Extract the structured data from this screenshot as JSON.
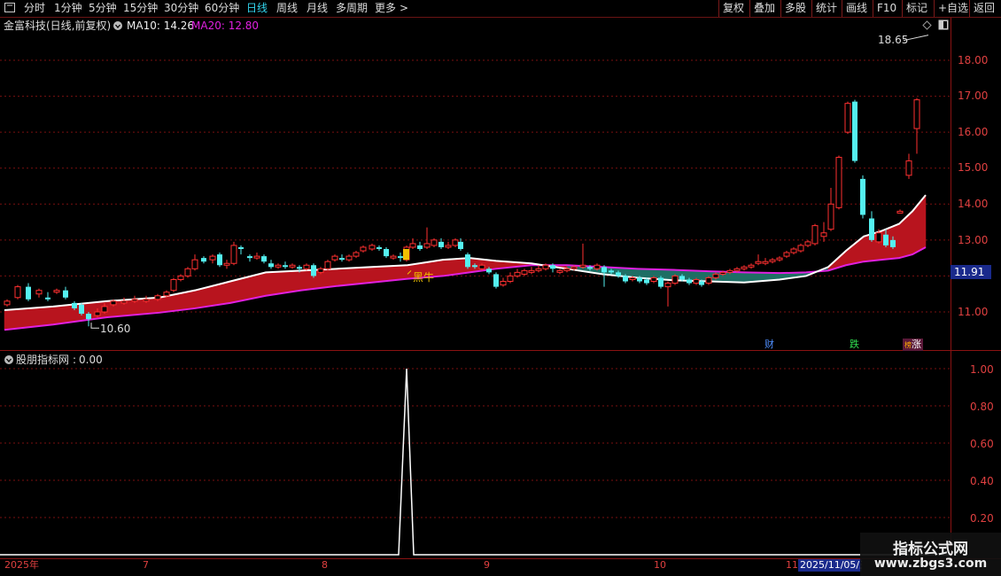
{
  "toolbar": {
    "left_items": [
      "分时",
      "1分钟",
      "5分钟",
      "15分钟",
      "30分钟",
      "60分钟",
      "日线",
      "周线",
      "月线",
      "多周期",
      "更多"
    ],
    "active": "日线",
    "more_arrow": ">",
    "right_items": [
      "复权",
      "叠加",
      "多股",
      "统计",
      "画线",
      "F10",
      "标记",
      "+自选",
      "返回"
    ]
  },
  "main": {
    "title": "金富科技(日线,前复权)",
    "ma10_label": "MA10: 14.26",
    "ma20_label": "MA20: 12.80",
    "high_label": "18.65",
    "low_label": "10.60",
    "signal_label": "黑牛",
    "current_price": "11.91",
    "markers": [
      "财",
      "跌",
      "涨"
    ],
    "y_ticks": [
      "18.00",
      "17.00",
      "16.00",
      "15.00",
      "14.00",
      "13.00",
      "12.00",
      "11.00"
    ]
  },
  "indicator": {
    "title": "股朋指标网",
    "value": "0.00",
    "y_ticks": [
      "1.00",
      "0.80",
      "0.60",
      "0.40",
      "0.20"
    ]
  },
  "x_axis": {
    "labels": [
      "2025年",
      "7",
      "8",
      "9",
      "10",
      "11"
    ],
    "cursor_date": "2025/11/05/三"
  },
  "watermark": {
    "title": "指标公式网",
    "url": "www.zbgs3.com"
  },
  "colors": {
    "up": "#ff3030",
    "down": "#54f0f0",
    "ma10": "#ffffff",
    "ma20": "#e020e0",
    "band_up": "#b8141e",
    "band_down": "#1e6e64",
    "grid": "#7a1010"
  }
}
